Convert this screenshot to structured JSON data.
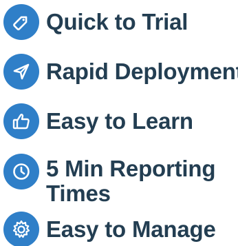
{
  "colors": {
    "icon_background": "#2f7fc8",
    "text": "#233e52",
    "icon_glyph": "#ffffff"
  },
  "features": [
    {
      "icon": "price-tag-icon",
      "label": "Quick to Trial"
    },
    {
      "icon": "paper-plane-icon",
      "label": "Rapid Deployment"
    },
    {
      "icon": "thumbs-up-icon",
      "label": "Easy to Learn"
    },
    {
      "icon": "clock-icon",
      "label": "5 Min Reporting Times"
    },
    {
      "icon": "gear-icon",
      "label": "Easy to Manage"
    }
  ]
}
